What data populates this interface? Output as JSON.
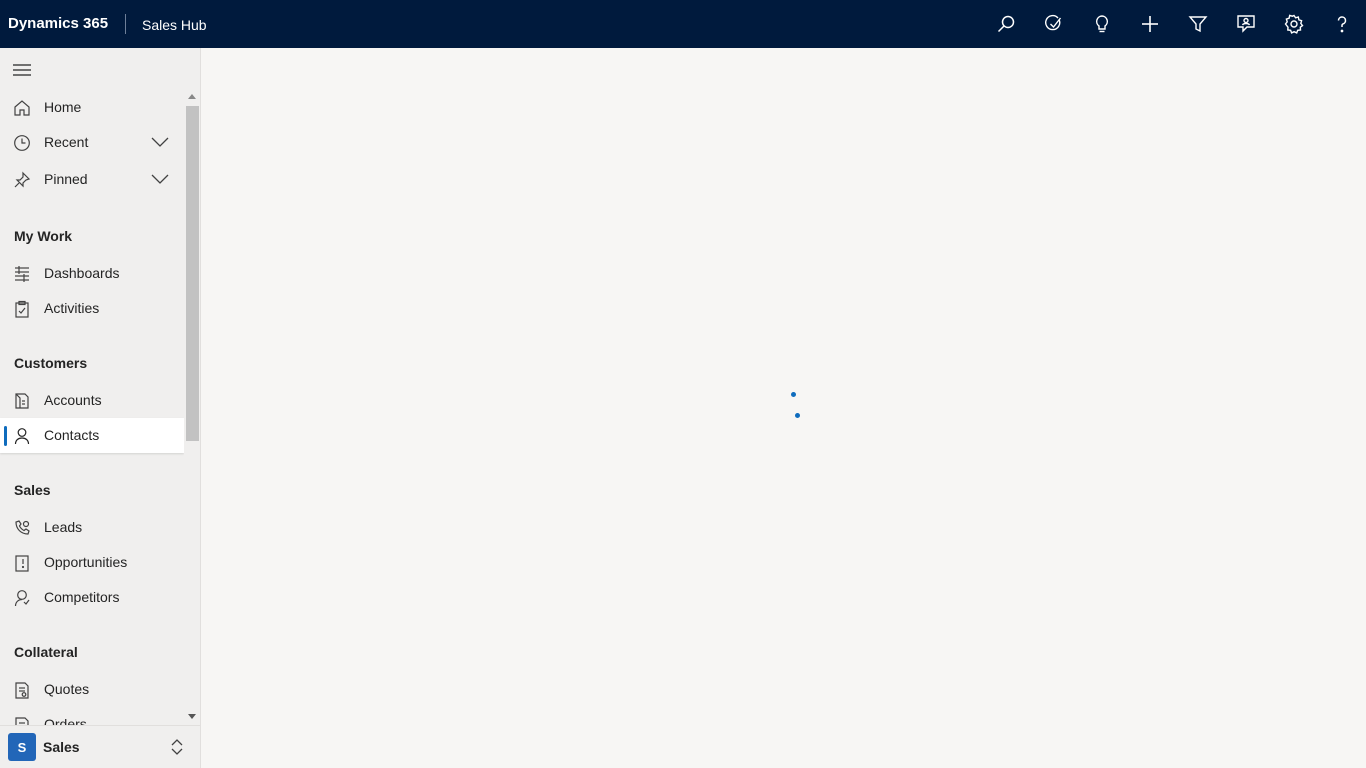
{
  "header": {
    "brand": "Dynamics 365",
    "app_name": "Sales Hub",
    "icons": [
      "search-icon",
      "task-flow-icon",
      "lightbulb-icon",
      "new-icon",
      "filter-icon",
      "assistant-icon",
      "settings-icon",
      "help-icon"
    ]
  },
  "colors": {
    "topbar": "#001a3d",
    "accent": "#0f6cbd",
    "area_badge": "#2266b8"
  },
  "sidebar": {
    "top_items": [
      {
        "label": "Home",
        "icon": "home-icon"
      },
      {
        "label": "Recent",
        "icon": "clock-icon",
        "expandable": true
      },
      {
        "label": "Pinned",
        "icon": "pin-icon",
        "expandable": true
      }
    ],
    "sections": [
      {
        "title": "My Work",
        "items": [
          {
            "label": "Dashboards",
            "icon": "dashboard-icon"
          },
          {
            "label": "Activities",
            "icon": "activities-icon"
          }
        ]
      },
      {
        "title": "Customers",
        "items": [
          {
            "label": "Accounts",
            "icon": "accounts-icon"
          },
          {
            "label": "Contacts",
            "icon": "person-icon",
            "selected": true
          }
        ]
      },
      {
        "title": "Sales",
        "items": [
          {
            "label": "Leads",
            "icon": "leads-icon"
          },
          {
            "label": "Opportunities",
            "icon": "opportunity-icon"
          },
          {
            "label": "Competitors",
            "icon": "competitor-icon"
          }
        ]
      },
      {
        "title": "Collateral",
        "items": [
          {
            "label": "Quotes",
            "icon": "quotes-icon"
          },
          {
            "label": "Orders",
            "icon": "orders-icon"
          }
        ]
      }
    ],
    "area": {
      "badge": "S",
      "label": "Sales"
    }
  },
  "main": {
    "state": "loading"
  }
}
